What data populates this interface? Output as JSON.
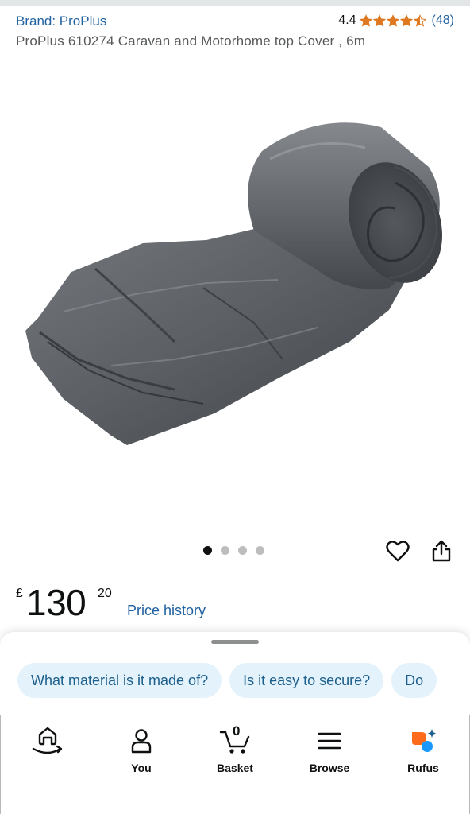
{
  "product": {
    "brand_label": "Brand: ProPlus",
    "rating_value": "4.4",
    "rating_stars": 4.4,
    "review_count": "(48)",
    "title": "ProPlus 610274 Caravan and Motorhome top Cover , 6m"
  },
  "gallery": {
    "image_count": 4,
    "active_index": 0
  },
  "price": {
    "symbol": "£",
    "whole": "130",
    "fraction": "20",
    "history_link": "Price history"
  },
  "suggestions": [
    "What material is it made of?",
    "Is it easy to secure?",
    "Do"
  ],
  "nav": {
    "home_label": "",
    "you_label": "You",
    "basket_label": "Basket",
    "basket_count": "0",
    "browse_label": "Browse",
    "rufus_label": "Rufus"
  },
  "colors": {
    "link": "#2162a1",
    "star": "#de7921",
    "chip_bg": "#e3f2fb",
    "rufus_orange": "#ff6b1a",
    "rufus_blue": "#1a98ff"
  },
  "icons": {
    "wishlist": "heart-icon",
    "share": "share-icon",
    "home": "home-icon",
    "you": "person-icon",
    "basket": "cart-icon",
    "browse": "menu-icon",
    "rufus": "rufus-icon"
  }
}
